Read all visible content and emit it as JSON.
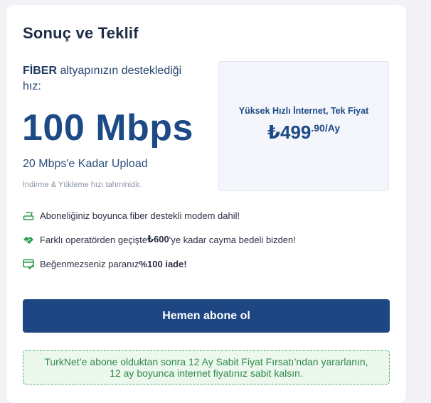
{
  "section": {
    "title": "Sonuç ve Teklif"
  },
  "speed_info": {
    "infra_bold": "FİBER",
    "infra_rest": " altyapınızın desteklediği hız:",
    "speed": "100 Mbps",
    "upload": "20 Mbps'e Kadar Upload",
    "disclaimer": "İndirme & Yükleme hızı tahminidir."
  },
  "offer": {
    "label": "Yüksek Hızlı İnternet, Tek Fiyat",
    "currency": "₺",
    "price_main": "499",
    "price_sup": ".90/Ay"
  },
  "features": [
    {
      "icon": "modem-icon",
      "text": "Aboneliğiniz boyunca fiber destekli modem dahil!",
      "bold": ""
    },
    {
      "icon": "handshake-icon",
      "text_before": "Farklı operatörden geçişte ",
      "bold": "₺600",
      "text_after": "'ye kadar cayma bedeli bizden!"
    },
    {
      "icon": "card-check-icon",
      "text_before": "Beğenmezseniz paranız ",
      "bold": "%100 iade!",
      "text_after": ""
    }
  ],
  "cta": {
    "label": "Hemen abone ol"
  },
  "notice": {
    "text": "TurkNet’e abone olduktan sonra 12 Ay Sabit Fiyat Fırsatı’ndan yararlanın, 12 ay boyunca internet fiyatınız sabit kalsın."
  },
  "colors": {
    "brand": "#1d4683",
    "success": "#2f8a45",
    "icon_green": "#2e9c4f"
  }
}
